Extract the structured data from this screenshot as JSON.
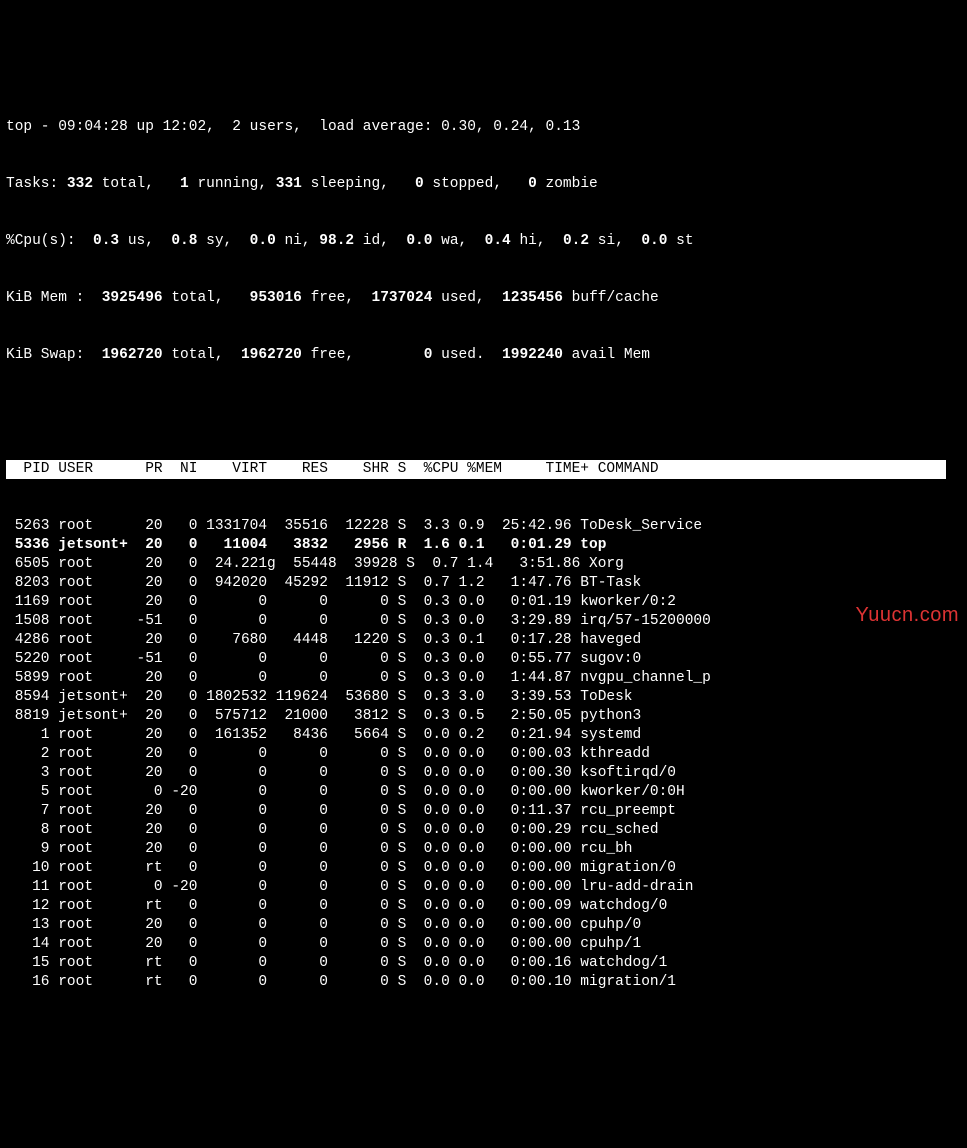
{
  "summary": {
    "line1_prefix": "top - ",
    "time": "09:04:28",
    "uptime": " up 12:02,  2 users,  load average: 0.30, 0.24, 0.13",
    "tasks_label": "Tasks: ",
    "tasks_total": "332",
    "tasks_total_suffix": " total,   ",
    "tasks_running": "1",
    "tasks_running_suffix": " running, ",
    "tasks_sleeping": "331",
    "tasks_sleeping_suffix": " sleeping,   ",
    "tasks_stopped": "0",
    "tasks_stopped_suffix": " stopped,   ",
    "tasks_zombie": "0",
    "tasks_zombie_suffix": " zombie",
    "cpu_label": "%Cpu(s):  ",
    "cpu_us": "0.3",
    "cpu_us_suffix": " us,  ",
    "cpu_sy": "0.8",
    "cpu_sy_suffix": " sy,  ",
    "cpu_ni": "0.0",
    "cpu_ni_suffix": " ni, ",
    "cpu_id": "98.2",
    "cpu_id_suffix": " id,  ",
    "cpu_wa": "0.0",
    "cpu_wa_suffix": " wa,  ",
    "cpu_hi": "0.4",
    "cpu_hi_suffix": " hi,  ",
    "cpu_si": "0.2",
    "cpu_si_suffix": " si,  ",
    "cpu_st": "0.0",
    "cpu_st_suffix": " st",
    "mem_label": "KiB Mem :  ",
    "mem_total": "3925496",
    "mem_total_suffix": " total,   ",
    "mem_free": "953016",
    "mem_free_suffix": " free,  ",
    "mem_used": "1737024",
    "mem_used_suffix": " used,  ",
    "mem_buff": "1235456",
    "mem_buff_suffix": " buff/cache",
    "swap_label": "KiB Swap:  ",
    "swap_total": "1962720",
    "swap_total_suffix": " total,  ",
    "swap_free": "1962720",
    "swap_free_suffix": " free,        ",
    "swap_used": "0",
    "swap_used_suffix": " used.  ",
    "swap_avail": "1992240",
    "swap_avail_suffix": " avail Mem"
  },
  "header": "  PID USER      PR  NI    VIRT    RES    SHR S  %CPU %MEM     TIME+ COMMAND                          ",
  "rows": [
    {
      "pid": " 5263",
      "user": "root    ",
      "pr": "  20",
      "ni": "   0",
      "virt": " 1331704",
      "res": "  35516",
      "shr": "  12228",
      "s": "S",
      "cpu": "  3.3",
      "mem": " 0.9",
      "time": "  25:42.96",
      "cmd": " ToDesk_Service",
      "bold": false
    },
    {
      "pid": " 5336",
      "user": "jetsont+",
      "pr": "  20",
      "ni": "   0",
      "virt": "   11004",
      "res": "   3832",
      "shr": "   2956",
      "s": "R",
      "cpu": "  1.6",
      "mem": " 0.1",
      "time": "   0:01.29",
      "cmd": " top",
      "bold": true
    },
    {
      "pid": " 6505",
      "user": "root    ",
      "pr": "  20",
      "ni": "   0",
      "virt": "  24.221g",
      "res": "  55448",
      "shr": "  39928",
      "s": "S",
      "cpu": "  0.7",
      "mem": " 1.4",
      "time": "   3:51.86",
      "cmd": " Xorg",
      "bold": false
    },
    {
      "pid": " 8203",
      "user": "root    ",
      "pr": "  20",
      "ni": "   0",
      "virt": "  942020",
      "res": "  45292",
      "shr": "  11912",
      "s": "S",
      "cpu": "  0.7",
      "mem": " 1.2",
      "time": "   1:47.76",
      "cmd": " BT-Task",
      "bold": false
    },
    {
      "pid": " 1169",
      "user": "root    ",
      "pr": "  20",
      "ni": "   0",
      "virt": "       0",
      "res": "      0",
      "shr": "      0",
      "s": "S",
      "cpu": "  0.3",
      "mem": " 0.0",
      "time": "   0:01.19",
      "cmd": " kworker/0:2",
      "bold": false
    },
    {
      "pid": " 1508",
      "user": "root    ",
      "pr": " -51",
      "ni": "   0",
      "virt": "       0",
      "res": "      0",
      "shr": "      0",
      "s": "S",
      "cpu": "  0.3",
      "mem": " 0.0",
      "time": "   3:29.89",
      "cmd": " irq/57-15200000",
      "bold": false
    },
    {
      "pid": " 4286",
      "user": "root    ",
      "pr": "  20",
      "ni": "   0",
      "virt": "    7680",
      "res": "   4448",
      "shr": "   1220",
      "s": "S",
      "cpu": "  0.3",
      "mem": " 0.1",
      "time": "   0:17.28",
      "cmd": " haveged",
      "bold": false
    },
    {
      "pid": " 5220",
      "user": "root    ",
      "pr": " -51",
      "ni": "   0",
      "virt": "       0",
      "res": "      0",
      "shr": "      0",
      "s": "S",
      "cpu": "  0.3",
      "mem": " 0.0",
      "time": "   0:55.77",
      "cmd": " sugov:0",
      "bold": false
    },
    {
      "pid": " 5899",
      "user": "root    ",
      "pr": "  20",
      "ni": "   0",
      "virt": "       0",
      "res": "      0",
      "shr": "      0",
      "s": "S",
      "cpu": "  0.3",
      "mem": " 0.0",
      "time": "   1:44.87",
      "cmd": " nvgpu_channel_p",
      "bold": false
    },
    {
      "pid": " 8594",
      "user": "jetsont+",
      "pr": "  20",
      "ni": "   0",
      "virt": " 1802532",
      "res": " 119624",
      "shr": "  53680",
      "s": "S",
      "cpu": "  0.3",
      "mem": " 3.0",
      "time": "   3:39.53",
      "cmd": " ToDesk",
      "bold": false
    },
    {
      "pid": " 8819",
      "user": "jetsont+",
      "pr": "  20",
      "ni": "   0",
      "virt": "  575712",
      "res": "  21000",
      "shr": "   3812",
      "s": "S",
      "cpu": "  0.3",
      "mem": " 0.5",
      "time": "   2:50.05",
      "cmd": " python3",
      "bold": false
    },
    {
      "pid": "    1",
      "user": "root    ",
      "pr": "  20",
      "ni": "   0",
      "virt": "  161352",
      "res": "   8436",
      "shr": "   5664",
      "s": "S",
      "cpu": "  0.0",
      "mem": " 0.2",
      "time": "   0:21.94",
      "cmd": " systemd",
      "bold": false
    },
    {
      "pid": "    2",
      "user": "root    ",
      "pr": "  20",
      "ni": "   0",
      "virt": "       0",
      "res": "      0",
      "shr": "      0",
      "s": "S",
      "cpu": "  0.0",
      "mem": " 0.0",
      "time": "   0:00.03",
      "cmd": " kthreadd",
      "bold": false
    },
    {
      "pid": "    3",
      "user": "root    ",
      "pr": "  20",
      "ni": "   0",
      "virt": "       0",
      "res": "      0",
      "shr": "      0",
      "s": "S",
      "cpu": "  0.0",
      "mem": " 0.0",
      "time": "   0:00.30",
      "cmd": " ksoftirqd/0",
      "bold": false
    },
    {
      "pid": "    5",
      "user": "root    ",
      "pr": "   0",
      "ni": " -20",
      "virt": "       0",
      "res": "      0",
      "shr": "      0",
      "s": "S",
      "cpu": "  0.0",
      "mem": " 0.0",
      "time": "   0:00.00",
      "cmd": " kworker/0:0H",
      "bold": false
    },
    {
      "pid": "    7",
      "user": "root    ",
      "pr": "  20",
      "ni": "   0",
      "virt": "       0",
      "res": "      0",
      "shr": "      0",
      "s": "S",
      "cpu": "  0.0",
      "mem": " 0.0",
      "time": "   0:11.37",
      "cmd": " rcu_preempt",
      "bold": false
    },
    {
      "pid": "    8",
      "user": "root    ",
      "pr": "  20",
      "ni": "   0",
      "virt": "       0",
      "res": "      0",
      "shr": "      0",
      "s": "S",
      "cpu": "  0.0",
      "mem": " 0.0",
      "time": "   0:00.29",
      "cmd": " rcu_sched",
      "bold": false
    },
    {
      "pid": "    9",
      "user": "root    ",
      "pr": "  20",
      "ni": "   0",
      "virt": "       0",
      "res": "      0",
      "shr": "      0",
      "s": "S",
      "cpu": "  0.0",
      "mem": " 0.0",
      "time": "   0:00.00",
      "cmd": " rcu_bh",
      "bold": false
    },
    {
      "pid": "   10",
      "user": "root    ",
      "pr": "  rt",
      "ni": "   0",
      "virt": "       0",
      "res": "      0",
      "shr": "      0",
      "s": "S",
      "cpu": "  0.0",
      "mem": " 0.0",
      "time": "   0:00.00",
      "cmd": " migration/0",
      "bold": false
    },
    {
      "pid": "   11",
      "user": "root    ",
      "pr": "   0",
      "ni": " -20",
      "virt": "       0",
      "res": "      0",
      "shr": "      0",
      "s": "S",
      "cpu": "  0.0",
      "mem": " 0.0",
      "time": "   0:00.00",
      "cmd": " lru-add-drain",
      "bold": false
    },
    {
      "pid": "   12",
      "user": "root    ",
      "pr": "  rt",
      "ni": "   0",
      "virt": "       0",
      "res": "      0",
      "shr": "      0",
      "s": "S",
      "cpu": "  0.0",
      "mem": " 0.0",
      "time": "   0:00.09",
      "cmd": " watchdog/0",
      "bold": false
    },
    {
      "pid": "   13",
      "user": "root    ",
      "pr": "  20",
      "ni": "   0",
      "virt": "       0",
      "res": "      0",
      "shr": "      0",
      "s": "S",
      "cpu": "  0.0",
      "mem": " 0.0",
      "time": "   0:00.00",
      "cmd": " cpuhp/0",
      "bold": false
    },
    {
      "pid": "   14",
      "user": "root    ",
      "pr": "  20",
      "ni": "   0",
      "virt": "       0",
      "res": "      0",
      "shr": "      0",
      "s": "S",
      "cpu": "  0.0",
      "mem": " 0.0",
      "time": "   0:00.00",
      "cmd": " cpuhp/1",
      "bold": false
    },
    {
      "pid": "   15",
      "user": "root    ",
      "pr": "  rt",
      "ni": "   0",
      "virt": "       0",
      "res": "      0",
      "shr": "      0",
      "s": "S",
      "cpu": "  0.0",
      "mem": " 0.0",
      "time": "   0:00.16",
      "cmd": " watchdog/1",
      "bold": false
    },
    {
      "pid": "   16",
      "user": "root    ",
      "pr": "  rt",
      "ni": "   0",
      "virt": "       0",
      "res": "      0",
      "shr": "      0",
      "s": "S",
      "cpu": "  0.0",
      "mem": " 0.0",
      "time": "   0:00.10",
      "cmd": " migration/1",
      "bold": false
    }
  ],
  "watermark": "Yuucn.com"
}
